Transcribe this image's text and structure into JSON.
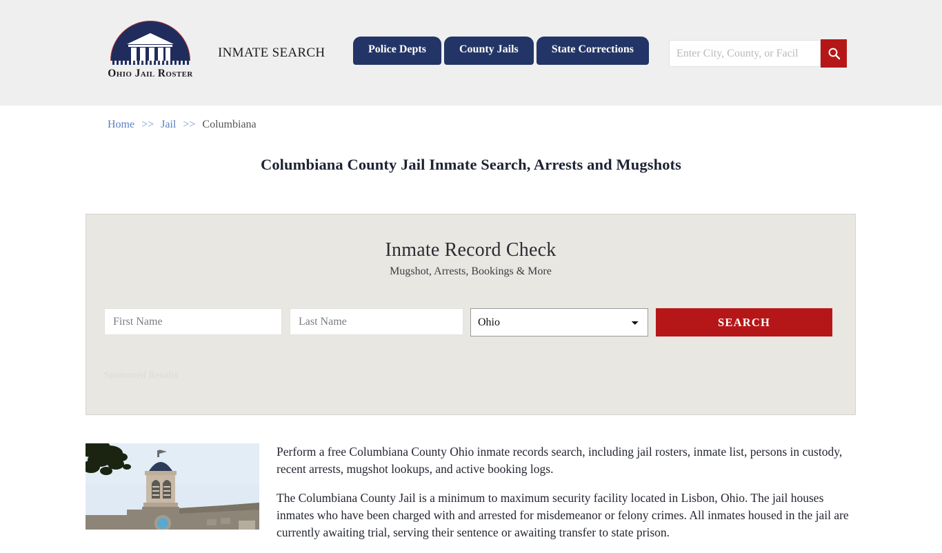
{
  "header": {
    "logo": {
      "icon": "courthouse-dome-logo",
      "text": "Ohio Jail Roster"
    },
    "tagline": "INMATE SEARCH",
    "nav": [
      {
        "label": "Police Depts"
      },
      {
        "label": "County Jails"
      },
      {
        "label": "State Corrections"
      }
    ],
    "search": {
      "placeholder": "Enter City, County, or Facil",
      "value": "",
      "button_icon": "search-icon"
    },
    "background_color": "#efefef"
  },
  "breadcrumb": {
    "home": "Home",
    "sep1": ">>",
    "jail": "Jail",
    "sep2": ">>",
    "current": "Columbiana"
  },
  "page_title": "Columbiana County Jail Inmate Search, Arrests and Mugshots",
  "record_check": {
    "title": "Inmate Record Check",
    "subtitle": "Mugshot, Arrests, Bookings & More",
    "first_name_placeholder": "First Name",
    "first_name_value": "",
    "last_name_placeholder": "Last Name",
    "last_name_value": "",
    "state_selected": "Ohio",
    "state_options": [
      "Ohio"
    ],
    "search_button": "SEARCH",
    "sponsored_label": "Sponsored Results",
    "accent_color": "#b51718",
    "card_background": "#e9e7e1"
  },
  "content": {
    "photo_alt": "columbiana-county-courthouse-photo",
    "paragraphs": [
      "Perform a free Columbiana County Ohio inmate records search, including jail rosters, inmate list, persons in custody, recent arrests, mugshot lookups, and active booking logs.",
      "The Columbiana County Jail is a minimum to maximum security facility located in Lisbon, Ohio. The jail houses inmates who have been charged with and arrested for misdemeanor or felony crimes. All inmates housed in the jail are currently awaiting trial, serving their sentence or awaiting transfer to state prison."
    ]
  }
}
